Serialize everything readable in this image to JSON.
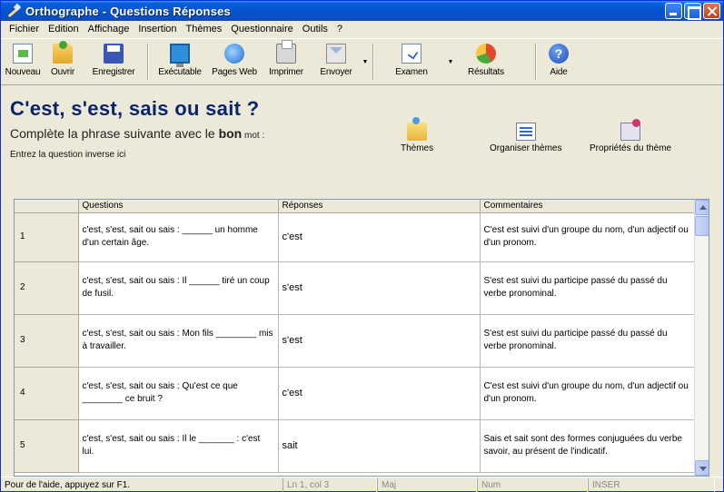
{
  "window": {
    "title": "Orthographe - Questions Réponses"
  },
  "menu": [
    "Fichier",
    "Edition",
    "Affichage",
    "Insertion",
    "Thèmes",
    "Questionnaire",
    "Outils",
    "?"
  ],
  "toolbar": {
    "new": "Nouveau",
    "open": "Ouvrir",
    "save": "Enregistrer",
    "exe": "Exécutable",
    "web": "Pages Web",
    "print": "Imprimer",
    "send": "Envoyer",
    "exam": "Examen",
    "results": "Résultats",
    "help": "Aide"
  },
  "header": {
    "title": "C'est, s'est, sais ou sait ?",
    "subtitle_pre": "Complète la phrase suivante avec le ",
    "subtitle_bold": "bon",
    "subtitle_post": " mot :",
    "inverse": "Entrez la question inverse ici",
    "themes": "Thèmes",
    "organize": "Organiser thèmes",
    "props": "Propriétés du thème"
  },
  "grid": {
    "headers": [
      "Questions",
      "Réponses",
      "Commentaires"
    ],
    "rows": [
      {
        "num": "1",
        "question": "c'est, s'est, sait ou sais : ______ un homme d'un certain âge.",
        "answer": "c'est",
        "comment": "C'est est suivi d'un groupe du nom, d'un adjectif ou d'un pronom."
      },
      {
        "num": "2",
        "question": "c'est, s'est, sait ou sais : Il ______ tiré un coup de fusil.",
        "answer": "s'est",
        "comment": "S'est est suivi du participe passé du passé du verbe pronominal."
      },
      {
        "num": "3",
        "question": "c'est, s'est, sait ou sais : Mon fils ________ mis à travailler.",
        "answer": "s'est",
        "comment": "S'est est suivi du participe passé du passé du verbe pronominal."
      },
      {
        "num": "4",
        "question": "c'est, s'est, sait ou sais : Qu'est ce que ________ ce bruit ?",
        "answer": "c'est",
        "comment": "C'est est suivi d'un groupe du nom, d'un adjectif ou d'un pronom."
      },
      {
        "num": "5",
        "question": "c'est, s'est, sait ou sais : Il le _______ : c'est lui.",
        "answer": "sait",
        "comment": "Sais et sait sont des formes conjuguées du verbe savoir, au présent de l'indicatif."
      }
    ]
  },
  "status": {
    "main": "Pour de l'aide, appuyez sur F1.",
    "pos": "Ln 1, col 3",
    "maj": "Maj",
    "num": "Num",
    "inser": "INSER"
  }
}
